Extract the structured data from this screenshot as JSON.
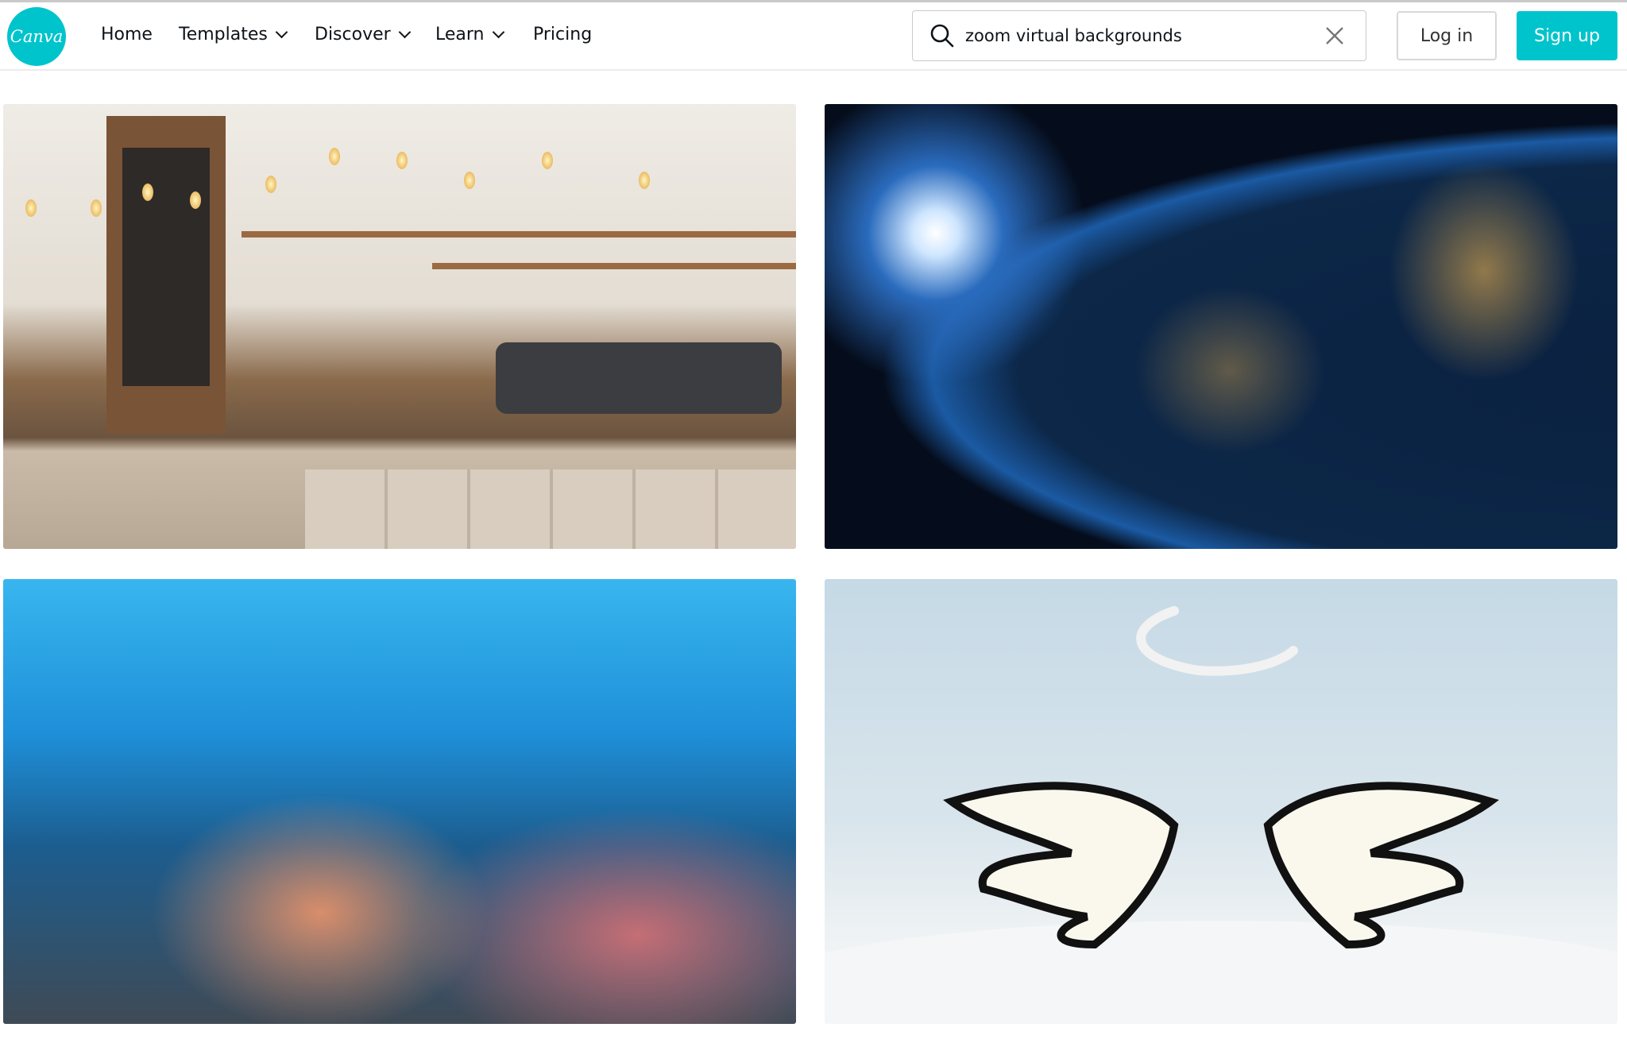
{
  "brand": {
    "logo_text": "Canva",
    "accent": "#00c4cc"
  },
  "nav": [
    {
      "label": "Home"
    },
    {
      "label": "Templates",
      "dropdown": true
    },
    {
      "label": "Discover",
      "dropdown": true
    },
    {
      "label": "Learn",
      "dropdown": true
    },
    {
      "label": "Pricing"
    }
  ],
  "search": {
    "value": "zoom virtual backgrounds",
    "icon": "search-icon",
    "clear_icon": "close-icon"
  },
  "auth": {
    "login": "Log in",
    "signup": "Sign up"
  },
  "results": [
    {
      "subject": "cafe"
    },
    {
      "subject": "earth-from-space"
    },
    {
      "subject": "coral-reef"
    },
    {
      "subject": "angel-wings-halo"
    }
  ]
}
